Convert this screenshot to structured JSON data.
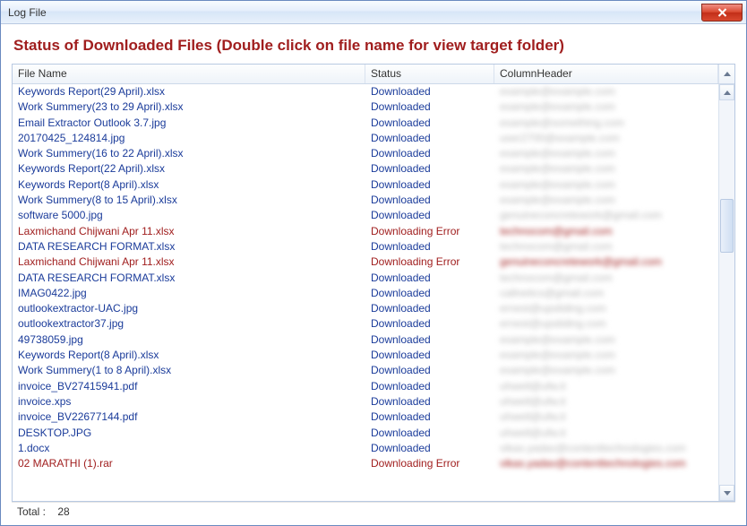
{
  "window": {
    "title": "Log File"
  },
  "heading": "Status of Downloaded Files (Double click on file name for view target folder)",
  "columns": {
    "file": "File Name",
    "status": "Status",
    "extra": "ColumnHeader"
  },
  "rows": [
    {
      "file": "Keywords Report(29 April).xlsx",
      "status": "Downloaded",
      "extra": "example@example.com",
      "error": false
    },
    {
      "file": "Work Summery(23 to 29 April).xlsx",
      "status": "Downloaded",
      "extra": "example@example.com",
      "error": false
    },
    {
      "file": "Email Extractor Outlook 3.7.jpg",
      "status": "Downloaded",
      "extra": "example@something.com",
      "error": false
    },
    {
      "file": "20170425_124814.jpg",
      "status": "Downloaded",
      "extra": "user2700@example.com",
      "error": false
    },
    {
      "file": "Work Summery(16 to 22 April).xlsx",
      "status": "Downloaded",
      "extra": "example@example.com",
      "error": false
    },
    {
      "file": "Keywords Report(22 April).xlsx",
      "status": "Downloaded",
      "extra": "example@example.com",
      "error": false
    },
    {
      "file": "Keywords Report(8 April).xlsx",
      "status": "Downloaded",
      "extra": "example@example.com",
      "error": false
    },
    {
      "file": "Work Summery(8 to 15 April).xlsx",
      "status": "Downloaded",
      "extra": "example@example.com",
      "error": false
    },
    {
      "file": "software 5000.jpg",
      "status": "Downloaded",
      "extra": "genuineconcretework@gmail.com",
      "error": false
    },
    {
      "file": "Laxmichand Chijwani Apr 11.xlsx",
      "status": "Downloading Error",
      "extra": "technocom@gmail.com",
      "error": true
    },
    {
      "file": "DATA RESEARCH FORMAT.xlsx",
      "status": "Downloaded",
      "extra": "technocom@gmail.com",
      "error": false
    },
    {
      "file": "Laxmichand Chijwani Apr 11.xlsx",
      "status": "Downloading Error",
      "extra": "genuineconcretework@gmail.com",
      "error": true
    },
    {
      "file": "DATA RESEARCH FORMAT.xlsx",
      "status": "Downloaded",
      "extra": "technocom@gmail.com",
      "error": false
    },
    {
      "file": "IMAG0422.jpg",
      "status": "Downloaded",
      "extra": "callnetics@gmail.com",
      "error": false
    },
    {
      "file": "outlookextractor-UAC.jpg",
      "status": "Downloaded",
      "extra": "ernest@upsliding.com",
      "error": false
    },
    {
      "file": "outlookextractor37.jpg",
      "status": "Downloaded",
      "extra": "ernest@upsliding.com",
      "error": false
    },
    {
      "file": "49738059.jpg",
      "status": "Downloaded",
      "extra": "example@example.com",
      "error": false
    },
    {
      "file": "Keywords Report(8 April).xlsx",
      "status": "Downloaded",
      "extra": "example@example.com",
      "error": false
    },
    {
      "file": "Work Summery(1 to 8 April).xlsx",
      "status": "Downloaded",
      "extra": "example@example.com",
      "error": false
    },
    {
      "file": "invoice_BV27415941.pdf",
      "status": "Downloaded",
      "extra": "uhwell@ufw.it",
      "error": false
    },
    {
      "file": "invoice.xps",
      "status": "Downloaded",
      "extra": "uhwell@ufw.it",
      "error": false
    },
    {
      "file": "invoice_BV22677144.pdf",
      "status": "Downloaded",
      "extra": "uhwell@ufw.it",
      "error": false
    },
    {
      "file": "DESKTOP.JPG",
      "status": "Downloaded",
      "extra": "uhwell@ufw.it",
      "error": false
    },
    {
      "file": "1.docx",
      "status": "Downloaded",
      "extra": "vikas.yadav@contenttechnologies.com",
      "error": false
    },
    {
      "file": "02 MARATHI (1).rar",
      "status": "Downloading Error",
      "extra": "vikas.yadav@contenttechnologies.com",
      "error": true
    }
  ],
  "footer": {
    "label": "Total :",
    "count": "28"
  }
}
